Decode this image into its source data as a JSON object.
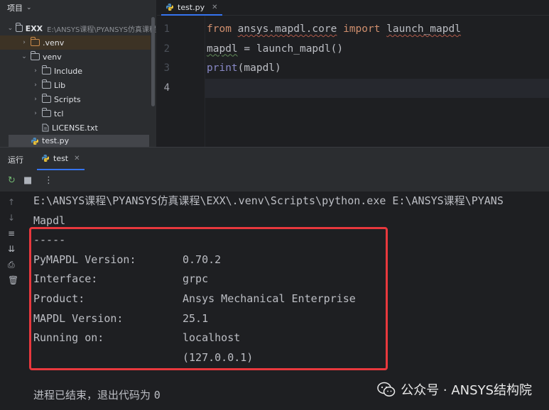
{
  "project": {
    "title": "项目",
    "root_name": "EXX",
    "root_path": "E:\\ANSYS课程\\PYANSYS仿真课程",
    "items": [
      {
        "label": ".venv"
      },
      {
        "label": "venv"
      },
      {
        "label": "Include"
      },
      {
        "label": "Lib"
      },
      {
        "label": "Scripts"
      },
      {
        "label": "tcl"
      },
      {
        "label": "LICENSE.txt"
      },
      {
        "label": "test.py"
      }
    ]
  },
  "editor": {
    "tab": "test.py",
    "line_numbers": [
      "1",
      "2",
      "3",
      "4"
    ],
    "code": {
      "l1": {
        "kw1": "from",
        "mod": "ansys.mapdl.core",
        "kw2": "import",
        "name": "launch_mapdl"
      },
      "l2": {
        "var": "mapdl",
        "eq": " = ",
        "call": "launch_mapdl()"
      },
      "l3": {
        "fn": "print",
        "arg": "(mapdl)"
      }
    }
  },
  "run": {
    "title": "运行",
    "tab": "test",
    "console": {
      "command": "E:\\ANSYS课程\\PYANSYS仿真课程\\EXX\\.venv\\Scripts\\python.exe E:\\ANSYS课程\\PYANS",
      "header": "Mapdl",
      "separator": "-----",
      "rows": [
        {
          "key": "PyMAPDL Version:",
          "value": "0.70.2"
        },
        {
          "key": "Interface:",
          "value": "grpc"
        },
        {
          "key": "Product:",
          "value": "Ansys Mechanical Enterprise"
        },
        {
          "key": "MAPDL Version:",
          "value": "25.1"
        },
        {
          "key": "Running on:",
          "value": "localhost"
        },
        {
          "key": "",
          "value": "(127.0.0.1)"
        }
      ],
      "exit_text": "进程已结束，退出代码为",
      "exit_code": "0"
    }
  },
  "watermark": "公众号 · ANSYS结构院",
  "colors": {
    "accent": "#3574f0",
    "highlight_box": "#e8383d",
    "keyword": "#cf8e6d",
    "builtin": "#8888c6"
  }
}
